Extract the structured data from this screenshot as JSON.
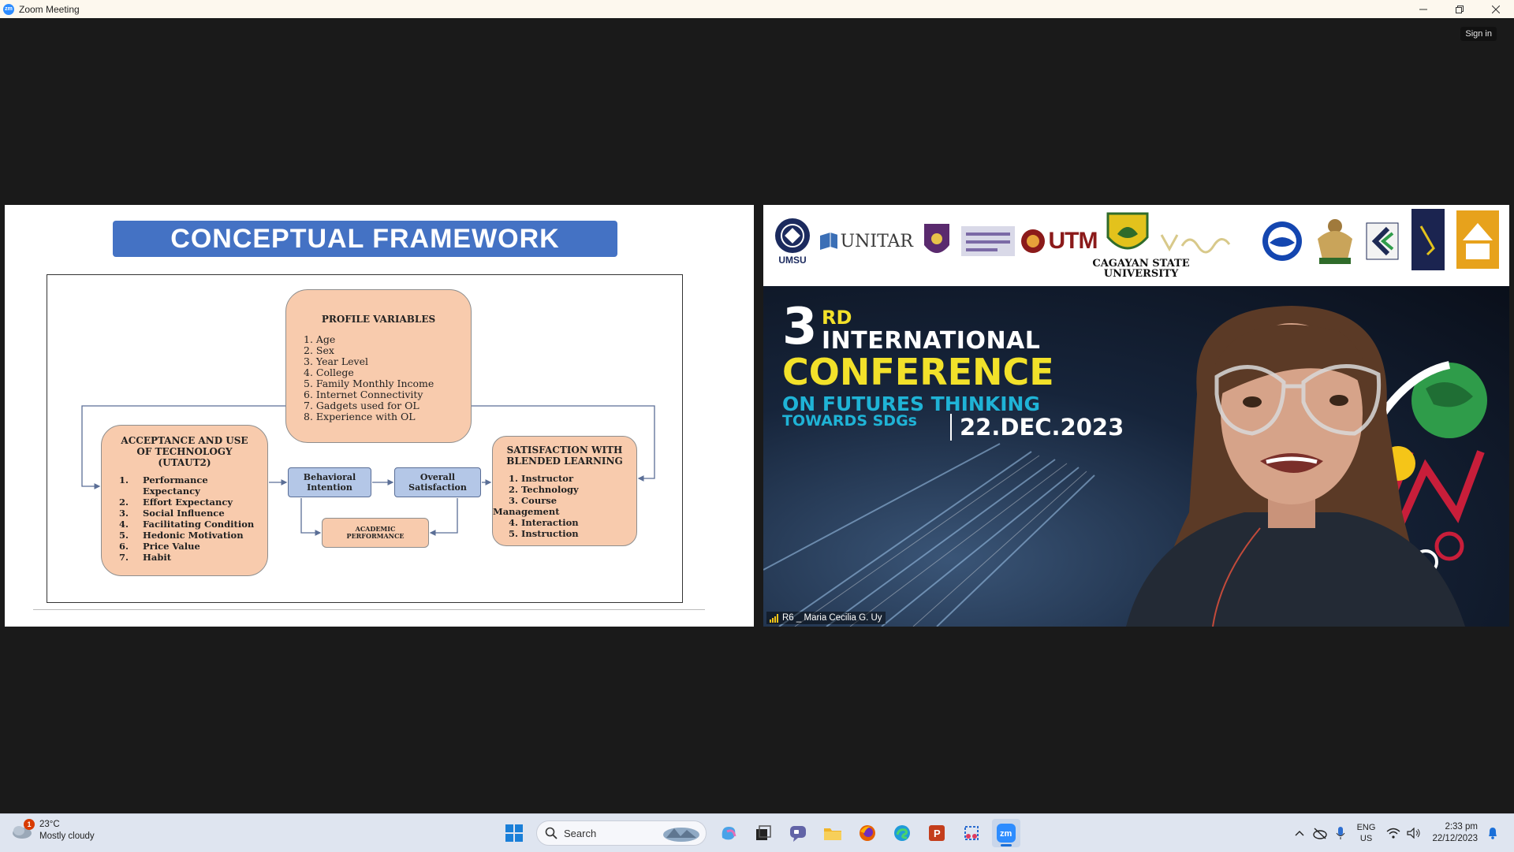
{
  "window": {
    "title": "Zoom Meeting",
    "sign_in": "Sign in"
  },
  "slide": {
    "title": "CONCEPTUAL  FRAMEWORK",
    "profile": {
      "heading": "PROFILE VARIABLES",
      "items": [
        "1. Age",
        "2. Sex",
        "3. Year Level",
        "4. College",
        "5. Family Monthly Income",
        "6. Internet Connectivity",
        "7. Gadgets used for OL",
        "8. Experience with OL"
      ]
    },
    "acceptance": {
      "heading_l1": "ACCEPTANCE AND USE",
      "heading_l2": "OF TECHNOLOGY",
      "heading_l3": "(UTAUT2)",
      "items": [
        {
          "n": "1.",
          "t": "Performance"
        },
        {
          "n": "",
          "t": "Expectancy"
        },
        {
          "n": "2.",
          "t": "Effort Expectancy"
        },
        {
          "n": "3.",
          "t": "Social Influence"
        },
        {
          "n": "4.",
          "t": "Facilitating Condition"
        },
        {
          "n": "5.",
          "t": "Hedonic Motivation"
        },
        {
          "n": "6.",
          "t": "Price Value"
        },
        {
          "n": "7.",
          "t": "Habit"
        }
      ]
    },
    "behavioral": {
      "l1": "Behavioral",
      "l2": "Intention"
    },
    "overall": {
      "l1": "Overall",
      "l2": "Satisfaction"
    },
    "academic": {
      "l1": "ACADEMIC",
      "l2": "PERFORMANCE"
    },
    "satisfaction": {
      "heading_l1": "SATISFACTION WITH",
      "heading_l2": "BLENDED LEARNING",
      "items": [
        "1. Instructor",
        "2. Technology",
        "3. Course",
        "Management",
        "4. Interaction",
        "5. Instruction"
      ]
    }
  },
  "video": {
    "logos": [
      "UMSU",
      "UNITAR",
      "UTM"
    ],
    "university": {
      "l1": "CAGAYAN STATE",
      "l2": "UNIVERSITY"
    },
    "conference": {
      "number": "3",
      "suffix": "RD",
      "line1": "INTERNATIONAL",
      "line2": "CONFERENCE",
      "line3": "ON FUTURES THINKING",
      "line4": "TOWARDS SDGs",
      "date": "22.DEC.2023"
    },
    "participant_name": "R6 _ Maria Cecilia G. Uy"
  },
  "taskbar": {
    "weather": {
      "temp": "23°C",
      "condition": "Mostly cloudy",
      "badge": "1"
    },
    "search_label": "Search",
    "language": {
      "l1": "ENG",
      "l2": "US"
    },
    "clock": {
      "time": "2:33 pm",
      "date": "22/12/2023"
    }
  },
  "colors": {
    "slide_title_bg": "#4472c4",
    "box_peach": "#f8cbad",
    "box_blue": "#b4c7e7",
    "conf_yellow": "#f2e12a",
    "conf_cyan": "#1fb3d6"
  }
}
